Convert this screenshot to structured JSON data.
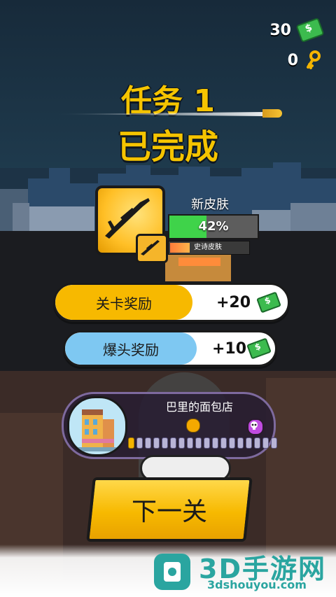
{
  "currency": {
    "cash": "30",
    "keys": "0"
  },
  "mission": {
    "line1": "任务 1",
    "line2": "已完成"
  },
  "skin": {
    "label": "新皮肤",
    "progress_text": "42%",
    "progress": 0.42,
    "rarity": "史诗皮肤"
  },
  "rewards": [
    {
      "label": "关卡奖励",
      "value": "+20",
      "color": "#f7b900"
    },
    {
      "label": "爆头奖励",
      "value": "+10",
      "color": "#7ec8f2"
    }
  ],
  "level": {
    "name": "巴里的面包店",
    "dots_total": 18,
    "dots_done": 1
  },
  "next_button": "下一关",
  "watermark": {
    "title": "3D手游网",
    "url": "3dshouyou.com"
  }
}
